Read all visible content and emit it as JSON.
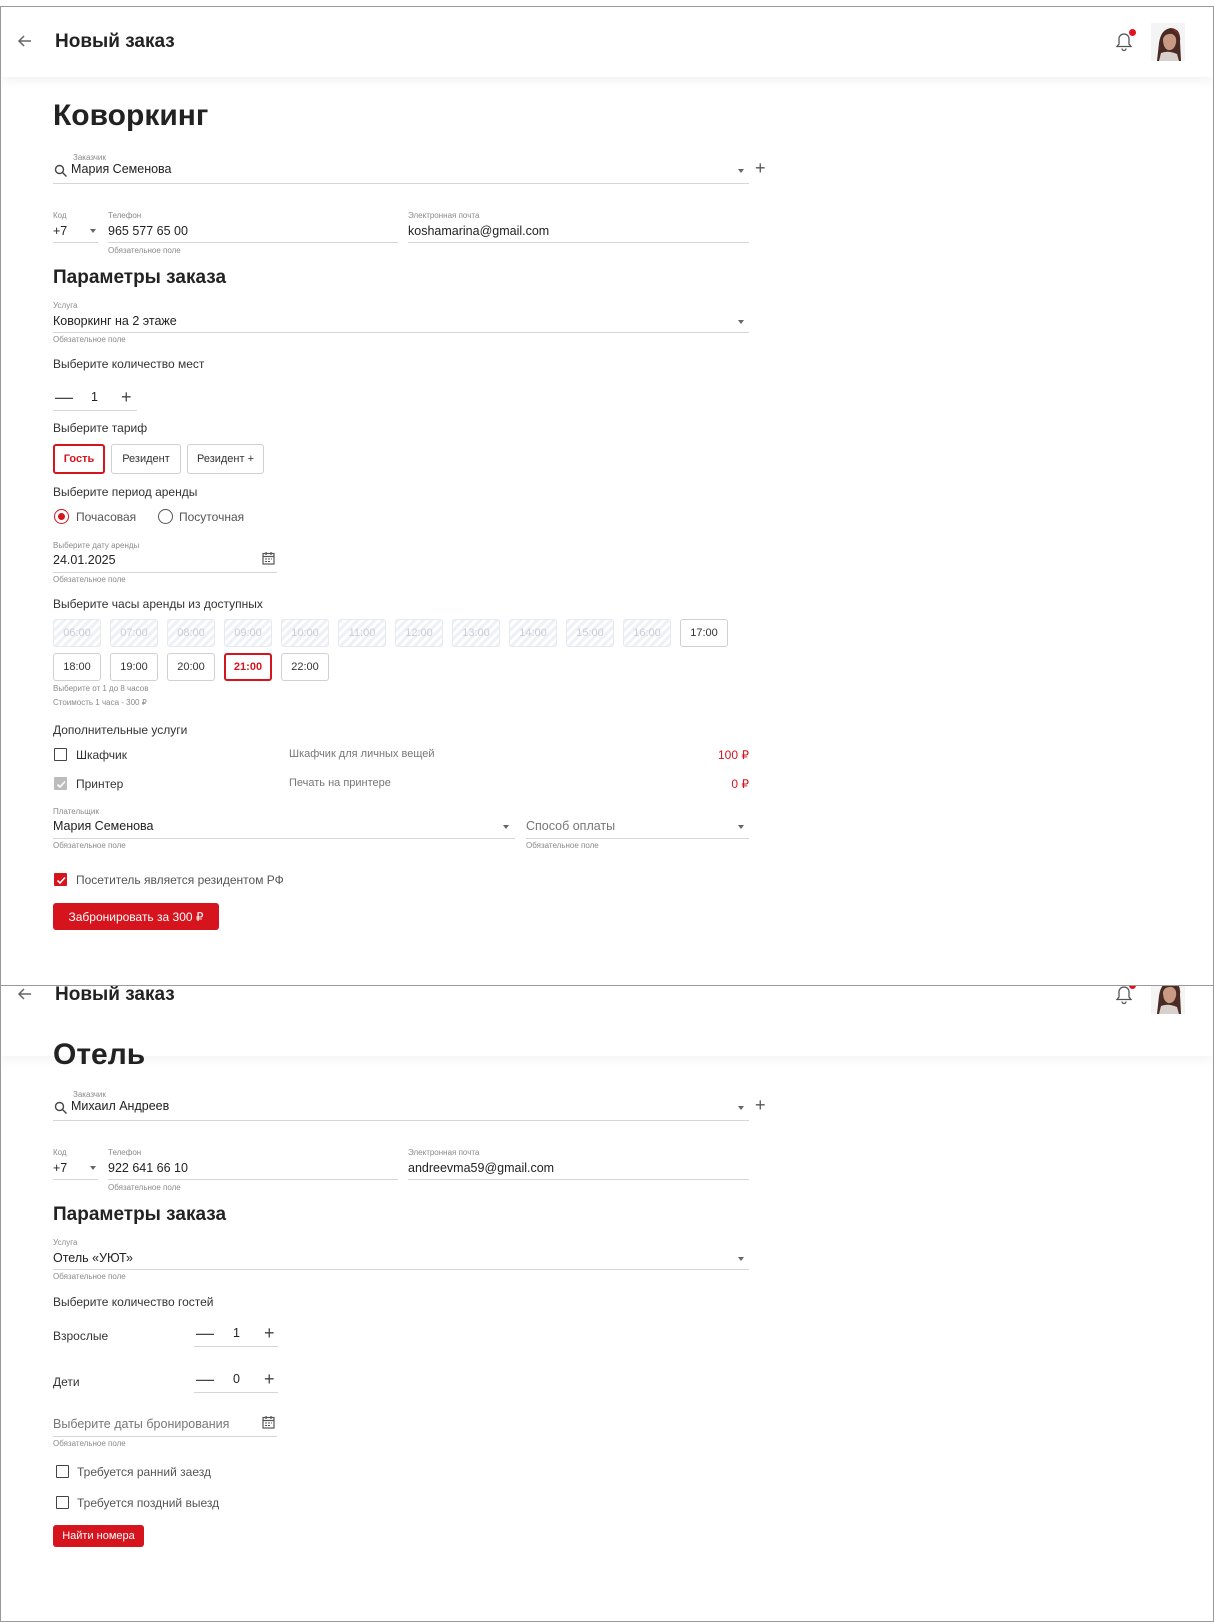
{
  "colors": {
    "accent": "#d5141e",
    "notification_dot": "#e1141e"
  },
  "icons": [
    "back-arrow-icon",
    "bell-icon",
    "avatar",
    "search-icon",
    "chevron-down-icon",
    "plus-icon",
    "minus-icon",
    "calendar-icon",
    "checkbox-icon",
    "radio-icon"
  ],
  "coworking": {
    "header": {
      "title": "Новый заказ"
    },
    "page_title": "Коворкинг",
    "customer": {
      "label": "Заказчик",
      "value": "Мария Семенова"
    },
    "code": {
      "label": "Код",
      "value": "+7"
    },
    "phone": {
      "label": "Телефон",
      "value": "965 577 65 00",
      "hint": "Обязательное поле"
    },
    "email": {
      "label": "Электронная почта",
      "value": "koshamarina@gmail.com"
    },
    "params_title": "Параметры заказа",
    "service": {
      "label": "Услуга",
      "value": "Коворкинг на 2 этаже",
      "hint": "Обязательное поле"
    },
    "seats": {
      "label": "Выберите количество мест",
      "value": "1"
    },
    "tariff": {
      "label": "Выберите тариф",
      "options": [
        "Гость",
        "Резидент",
        "Резидент +"
      ],
      "selected": "Гость"
    },
    "period": {
      "label": "Выберите период аренды",
      "options": [
        "Почасовая",
        "Посуточная"
      ],
      "selected": "Почасовая"
    },
    "date": {
      "label": "Выберите дату аренды",
      "value": "24.01.2025",
      "hint": "Обязательное поле"
    },
    "hours": {
      "label": "Выберите часы аренды из доступных",
      "slots": [
        "06:00",
        "07:00",
        "08:00",
        "09:00",
        "10:00",
        "11:00",
        "12:00",
        "13:00",
        "14:00",
        "15:00",
        "16:00",
        "17:00",
        "18:00",
        "19:00",
        "20:00",
        "21:00",
        "22:00"
      ],
      "disabled": [
        "06:00",
        "07:00",
        "08:00",
        "09:00",
        "10:00",
        "11:00",
        "12:00",
        "13:00",
        "14:00",
        "15:00",
        "16:00"
      ],
      "selected": "21:00",
      "hint1": "Выберите от 1 до 8 часов",
      "hint2": "Стоимость 1 часа - 300 ₽"
    },
    "extras": {
      "label": "Дополнительные услуги",
      "items": [
        {
          "name": "Шкафчик",
          "desc": "Шкафчик для личных вещей",
          "price": "100 ₽",
          "checked": false
        },
        {
          "name": "Принтер",
          "desc": "Печать на принтере",
          "price": "0 ₽",
          "checked": true
        }
      ]
    },
    "payer": {
      "label": "Плательщик",
      "value": "Мария Семенова",
      "hint": "Обязательное поле"
    },
    "payment": {
      "placeholder": "Способ оплаты",
      "hint": "Обязательное поле"
    },
    "resident_check": {
      "label": "Посетитель является резидентом РФ",
      "checked": true
    },
    "submit": "Забронировать за 300 ₽"
  },
  "hotel": {
    "header": {
      "title": "Новый заказ"
    },
    "page_title": "Отель",
    "customer": {
      "label": "Заказчик",
      "value": "Михаил Андреев"
    },
    "code": {
      "label": "Код",
      "value": "+7"
    },
    "phone": {
      "label": "Телефон",
      "value": "922 641 66 10",
      "hint": "Обязательное поле"
    },
    "email": {
      "label": "Электронная почта",
      "value": "andreevma59@gmail.com"
    },
    "params_title": "Параметры заказа",
    "service": {
      "label": "Услуга",
      "value": "Отель «УЮТ»",
      "hint": "Обязательное поле"
    },
    "guests": {
      "label": "Выберите количество гостей",
      "adults_label": "Взрослые",
      "adults": "1",
      "children_label": "Дети",
      "children": "0"
    },
    "dates": {
      "placeholder": "Выберите даты бронирования",
      "hint": "Обязательное поле"
    },
    "early_checkin": {
      "label": "Требуется ранний заезд",
      "checked": false
    },
    "late_checkout": {
      "label": "Требуется поздний выезд",
      "checked": false
    },
    "submit": "Найти номера"
  }
}
